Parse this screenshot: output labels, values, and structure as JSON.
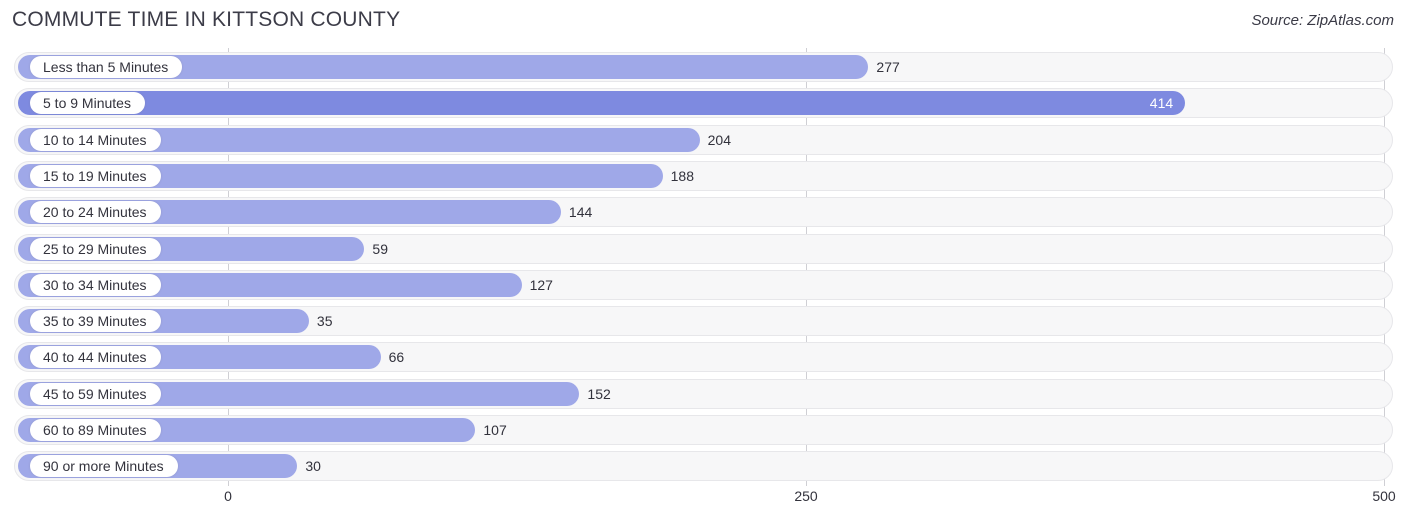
{
  "header": {
    "title": "COMMUTE TIME IN KITTSON COUNTY",
    "source": "Source: ZipAtlas.com"
  },
  "colors": {
    "bar": "#9fa8e8",
    "bar_max": "#7e8ae0",
    "track": "#f7f7f8",
    "gridline": "#cfcfd4",
    "text": "#33333d"
  },
  "chart_data": {
    "type": "bar",
    "orientation": "horizontal",
    "title": "COMMUTE TIME IN KITTSON COUNTY",
    "xlabel": "",
    "ylabel": "",
    "xlim": [
      0,
      500
    ],
    "ticks": [
      "0",
      "250",
      "500"
    ],
    "tick_values": [
      0,
      250,
      500
    ],
    "grid": true,
    "legend": null,
    "categories": [
      "Less than 5 Minutes",
      "5 to 9 Minutes",
      "10 to 14 Minutes",
      "15 to 19 Minutes",
      "20 to 24 Minutes",
      "25 to 29 Minutes",
      "30 to 34 Minutes",
      "35 to 39 Minutes",
      "40 to 44 Minutes",
      "45 to 59 Minutes",
      "60 to 89 Minutes",
      "90 or more Minutes"
    ],
    "values": [
      277,
      414,
      204,
      188,
      144,
      59,
      127,
      35,
      66,
      152,
      107,
      30
    ],
    "value_labels": [
      "277",
      "414",
      "204",
      "188",
      "144",
      "59",
      "127",
      "35",
      "66",
      "152",
      "107",
      "30"
    ],
    "max_index": 1
  }
}
